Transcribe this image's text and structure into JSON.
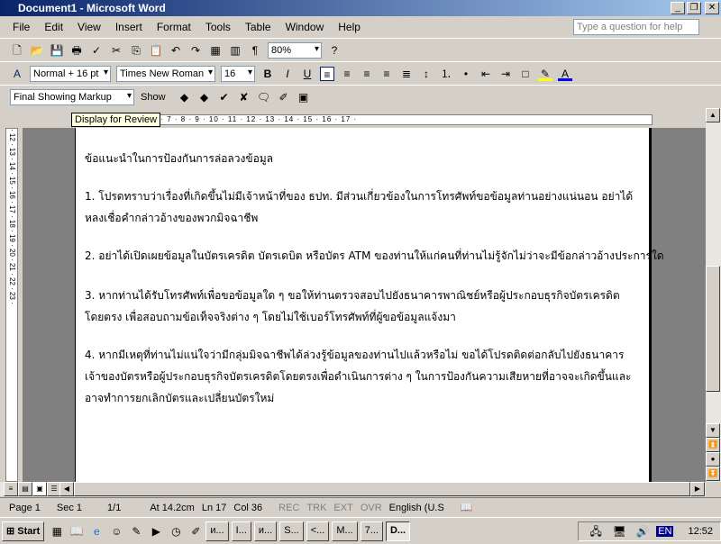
{
  "window": {
    "title": "Document1 - Microsoft Word"
  },
  "menu": [
    "File",
    "Edit",
    "View",
    "Insert",
    "Format",
    "Tools",
    "Table",
    "Window",
    "Help"
  ],
  "help_placeholder": "Type a question for help",
  "toolbar": {
    "zoom": "80%",
    "style": "Normal + 16 pt",
    "font": "Times New Roman",
    "size": "16",
    "markup": "Final Showing Markup",
    "show": "Show"
  },
  "tooltip": "Display for Review",
  "ruler": {
    "numbers": "· 1 · 2 · 3 · 4 · 5 · 6 · 7 · 8 · 9 · 10 · 11 · 12 · 13 · 14 · 15 · 16 · 17 ·",
    "vnumbers": "· 12 · 13 · 14 · 15 · 16 · 17 · 18 · 19 · 20 · 21 · 22 · 23 ·"
  },
  "document": {
    "heading": "ข้อแนะนำในการป้องกันการล่อลวงข้อมูล",
    "paragraphs": [
      "1. โปรดทราบว่าเรื่องที่เกิดขึ้นไม่มีเจ้าหน้าที่ของ ธปท. มีส่วนเกี่ยวข้องในการโทรศัพท์ขอข้อมูลท่านอย่างแน่นอน อย่าได้หลงเชื่อคำกล่าวอ้างของพวกมิจฉาชีพ",
      "2. อย่าได้เปิดเผยข้อมูลในบัตรเครดิต บัตรเดบิต หรือบัตร ATM ของท่านให้แก่คนที่ท่านไม่รู้จักไม่ว่าจะมีข้อกล่าวอ้างประการใด",
      "3. หากท่านได้รับโทรศัพท์เพื่อขอข้อมูลใด ๆ ขอให้ท่านตรวจสอบไปยังธนาคารพาณิชย์หรือผู้ประกอบธุรกิจบัตรเครดิตโดยตรง เพื่อสอบถามข้อเท็จจริงต่าง ๆ โดยไม่ใช้เบอร์โทรศัพท์ที่ผู้ขอข้อมูลแจ้งมา",
      "4. หากมีเหตุที่ท่านไม่แน่ใจว่ามีกลุ่มมิจฉาชีพได้ล่วงรู้ข้อมูลของท่านไปแล้วหรือไม่ ขอได้โปรดติดต่อกลับไปยังธนาคารเจ้าของบัตรหรือผู้ประกอบธุรกิจบัตรเครดิตโดยตรงเพื่อดำเนินการต่าง ๆ ในการป้องกันความเสียหายที่อาจจะเกิดขึ้นและอาจทำการยกเลิกบัตรและเปลี่ยนบัตรใหม่"
    ]
  },
  "status": {
    "page": "Page 1",
    "sec": "Sec 1",
    "pages": "1/1",
    "at": "At 14.2cm",
    "ln": "Ln 17",
    "col": "Col 36",
    "rec": "REC",
    "trk": "TRK",
    "ext": "EXT",
    "ovr": "OVR",
    "lang": "English (U.S"
  },
  "taskbar": {
    "start": "Start",
    "buttons": [
      "и...",
      "I...",
      "и...",
      "S...",
      "<...",
      "M...",
      "7...",
      "D..."
    ],
    "lang": "EN",
    "clock": "12:52"
  }
}
